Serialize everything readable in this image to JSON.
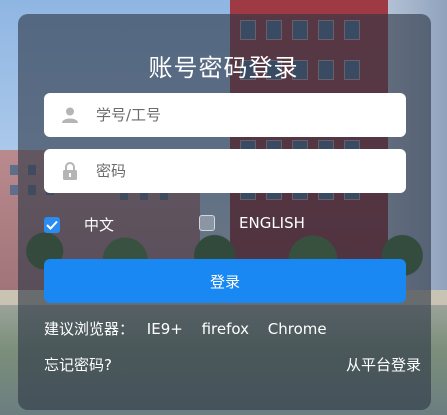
{
  "login": {
    "title": "账号密码登录",
    "username": {
      "placeholder": "学号/工号",
      "value": ""
    },
    "password": {
      "placeholder": "密码",
      "value": ""
    },
    "languages": [
      {
        "label": "中文",
        "checked": true
      },
      {
        "label": "ENGLISH",
        "checked": false
      }
    ],
    "submit_label": "登录",
    "browsers": {
      "prefix": "建议浏览器：",
      "items": [
        "IE9+",
        "firefox",
        "Chrome"
      ]
    },
    "forgot_label": "忘记密码?",
    "platform_login_label": "从平台登录"
  },
  "icons": {
    "username": "user-icon",
    "password": "lock-icon",
    "checked": "check-icon"
  },
  "colors": {
    "accent": "#1a88f2",
    "checkbox_checked": "#2a8cf0",
    "panel": "rgba(45,55,70,0.62)"
  }
}
